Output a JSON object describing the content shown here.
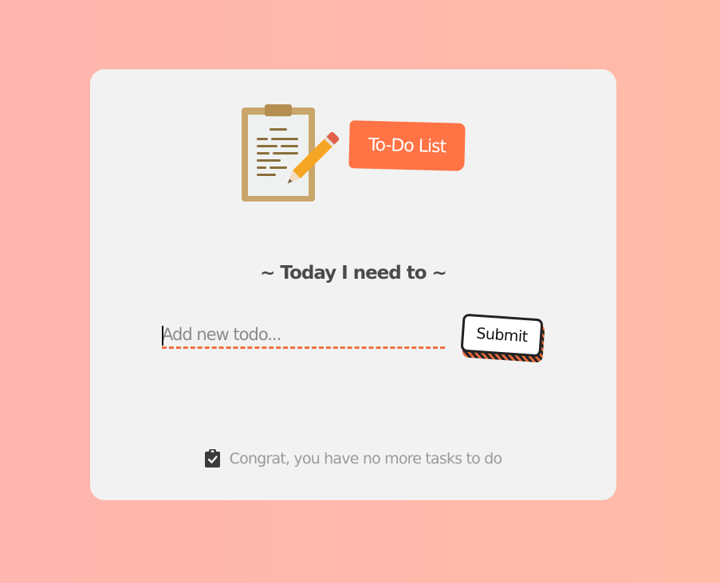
{
  "app": {
    "tag_label": "To-Do List",
    "heading": "~ Today I need to ~"
  },
  "form": {
    "placeholder": "Add new todo...",
    "value": "",
    "submit_label": "Submit"
  },
  "empty_state": {
    "icon": "clipboard-check-icon",
    "message": "Congrat, you have no more tasks to do"
  },
  "colors": {
    "background_start": "#ffb6ae",
    "background_end": "#ffbaa8",
    "card": "#f2f2f2",
    "accent": "#ff7345",
    "heading": "#4a4a4a",
    "muted_text": "#9a9a9a"
  }
}
